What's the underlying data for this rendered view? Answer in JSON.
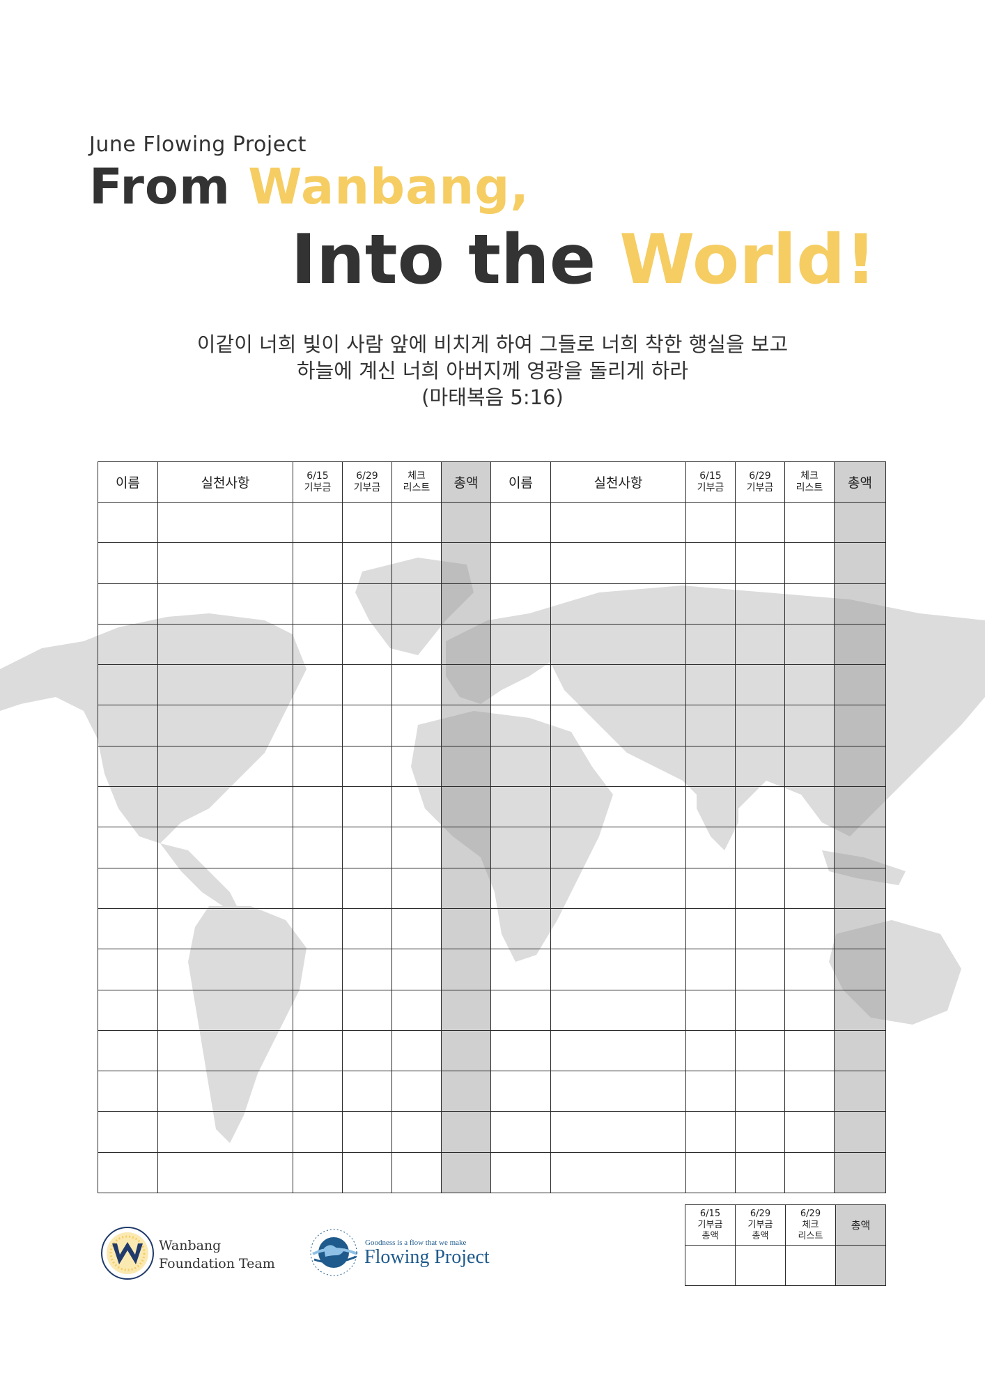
{
  "header": {
    "subtitle": "June Flowing Project",
    "title_line1_part1": "From ",
    "title_line1_part2": "Wanbang,",
    "title_line2_part1": "Into the ",
    "title_line2_part2": "World!"
  },
  "verse": {
    "line1": "이같이 너희 빛이 사람 앞에 비치게 하여 그들로 너희 착한 행실을 보고",
    "line2": "하늘에 계신 너희 아버지께 영광을 돌리게 하라",
    "line3": "(마태복음 5:16)"
  },
  "main_table": {
    "headers": {
      "name": "이름",
      "practice": "실천사항",
      "d615_a": "6/15",
      "d615_b": "기부금",
      "d629_a": "6/29",
      "d629_b": "기부금",
      "check_a": "체크",
      "check_b": "리스트",
      "total": "총액"
    },
    "row_count": 17
  },
  "summary_table": {
    "h1_a": "6/15",
    "h1_b": "기부금",
    "h1_c": "총액",
    "h2_a": "6/29",
    "h2_b": "기부금",
    "h2_c": "총액",
    "h3_a": "6/29",
    "h3_b": "체크",
    "h3_c": "리스트",
    "h4": "총액"
  },
  "logos": {
    "wanbang_line1": "Wanbang",
    "wanbang_line2": "Foundation Team",
    "flowing_tagline": "Goodness is a flow that we make",
    "flowing_name": "Flowing Project"
  },
  "colors": {
    "gold": "#F5CD63",
    "dark": "#333333",
    "map_gray": "#d9d9d9",
    "total_column": "#b4b4b4",
    "logo_blue": "#1e5a8c"
  }
}
